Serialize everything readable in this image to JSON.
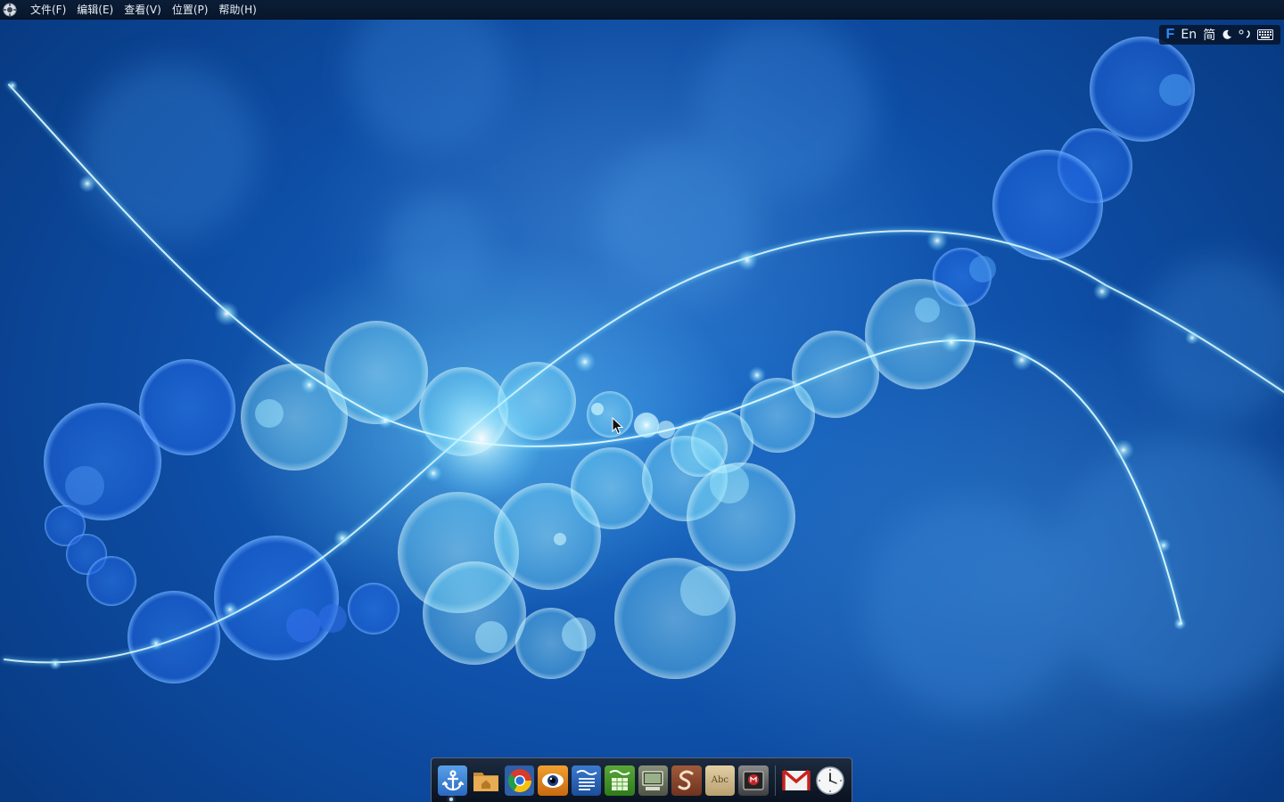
{
  "top_panel": {
    "menus": [
      {
        "label": "文件(F)"
      },
      {
        "label": "编辑(E)"
      },
      {
        "label": "查看(V)"
      },
      {
        "label": "位置(P)"
      },
      {
        "label": "帮助(H)"
      }
    ]
  },
  "tray": {
    "ime_logo": "F",
    "language": "En",
    "script": "简",
    "icons": [
      "input-method-icon",
      "moon-icon",
      "punctuation-icon",
      "keyboard-icon"
    ]
  },
  "dock": {
    "icons": [
      {
        "name": "anchor-icon"
      },
      {
        "name": "home-folder-icon"
      },
      {
        "name": "chrome-browser-icon"
      },
      {
        "name": "eye-viewer-icon"
      },
      {
        "name": "writer-document-icon"
      },
      {
        "name": "calc-spreadsheet-icon"
      },
      {
        "name": "screen-monitor-icon"
      },
      {
        "name": "script-s-icon"
      },
      {
        "name": "dictionary-icon",
        "label": "Abc"
      },
      {
        "name": "media-player-icon"
      },
      {
        "name": "gmail-icon"
      },
      {
        "name": "clock-icon"
      }
    ]
  },
  "colors": {
    "panel_bg": "#07162b",
    "desktop_blue": "#0e4ea6",
    "glow_cyan": "#7fe3ff"
  }
}
